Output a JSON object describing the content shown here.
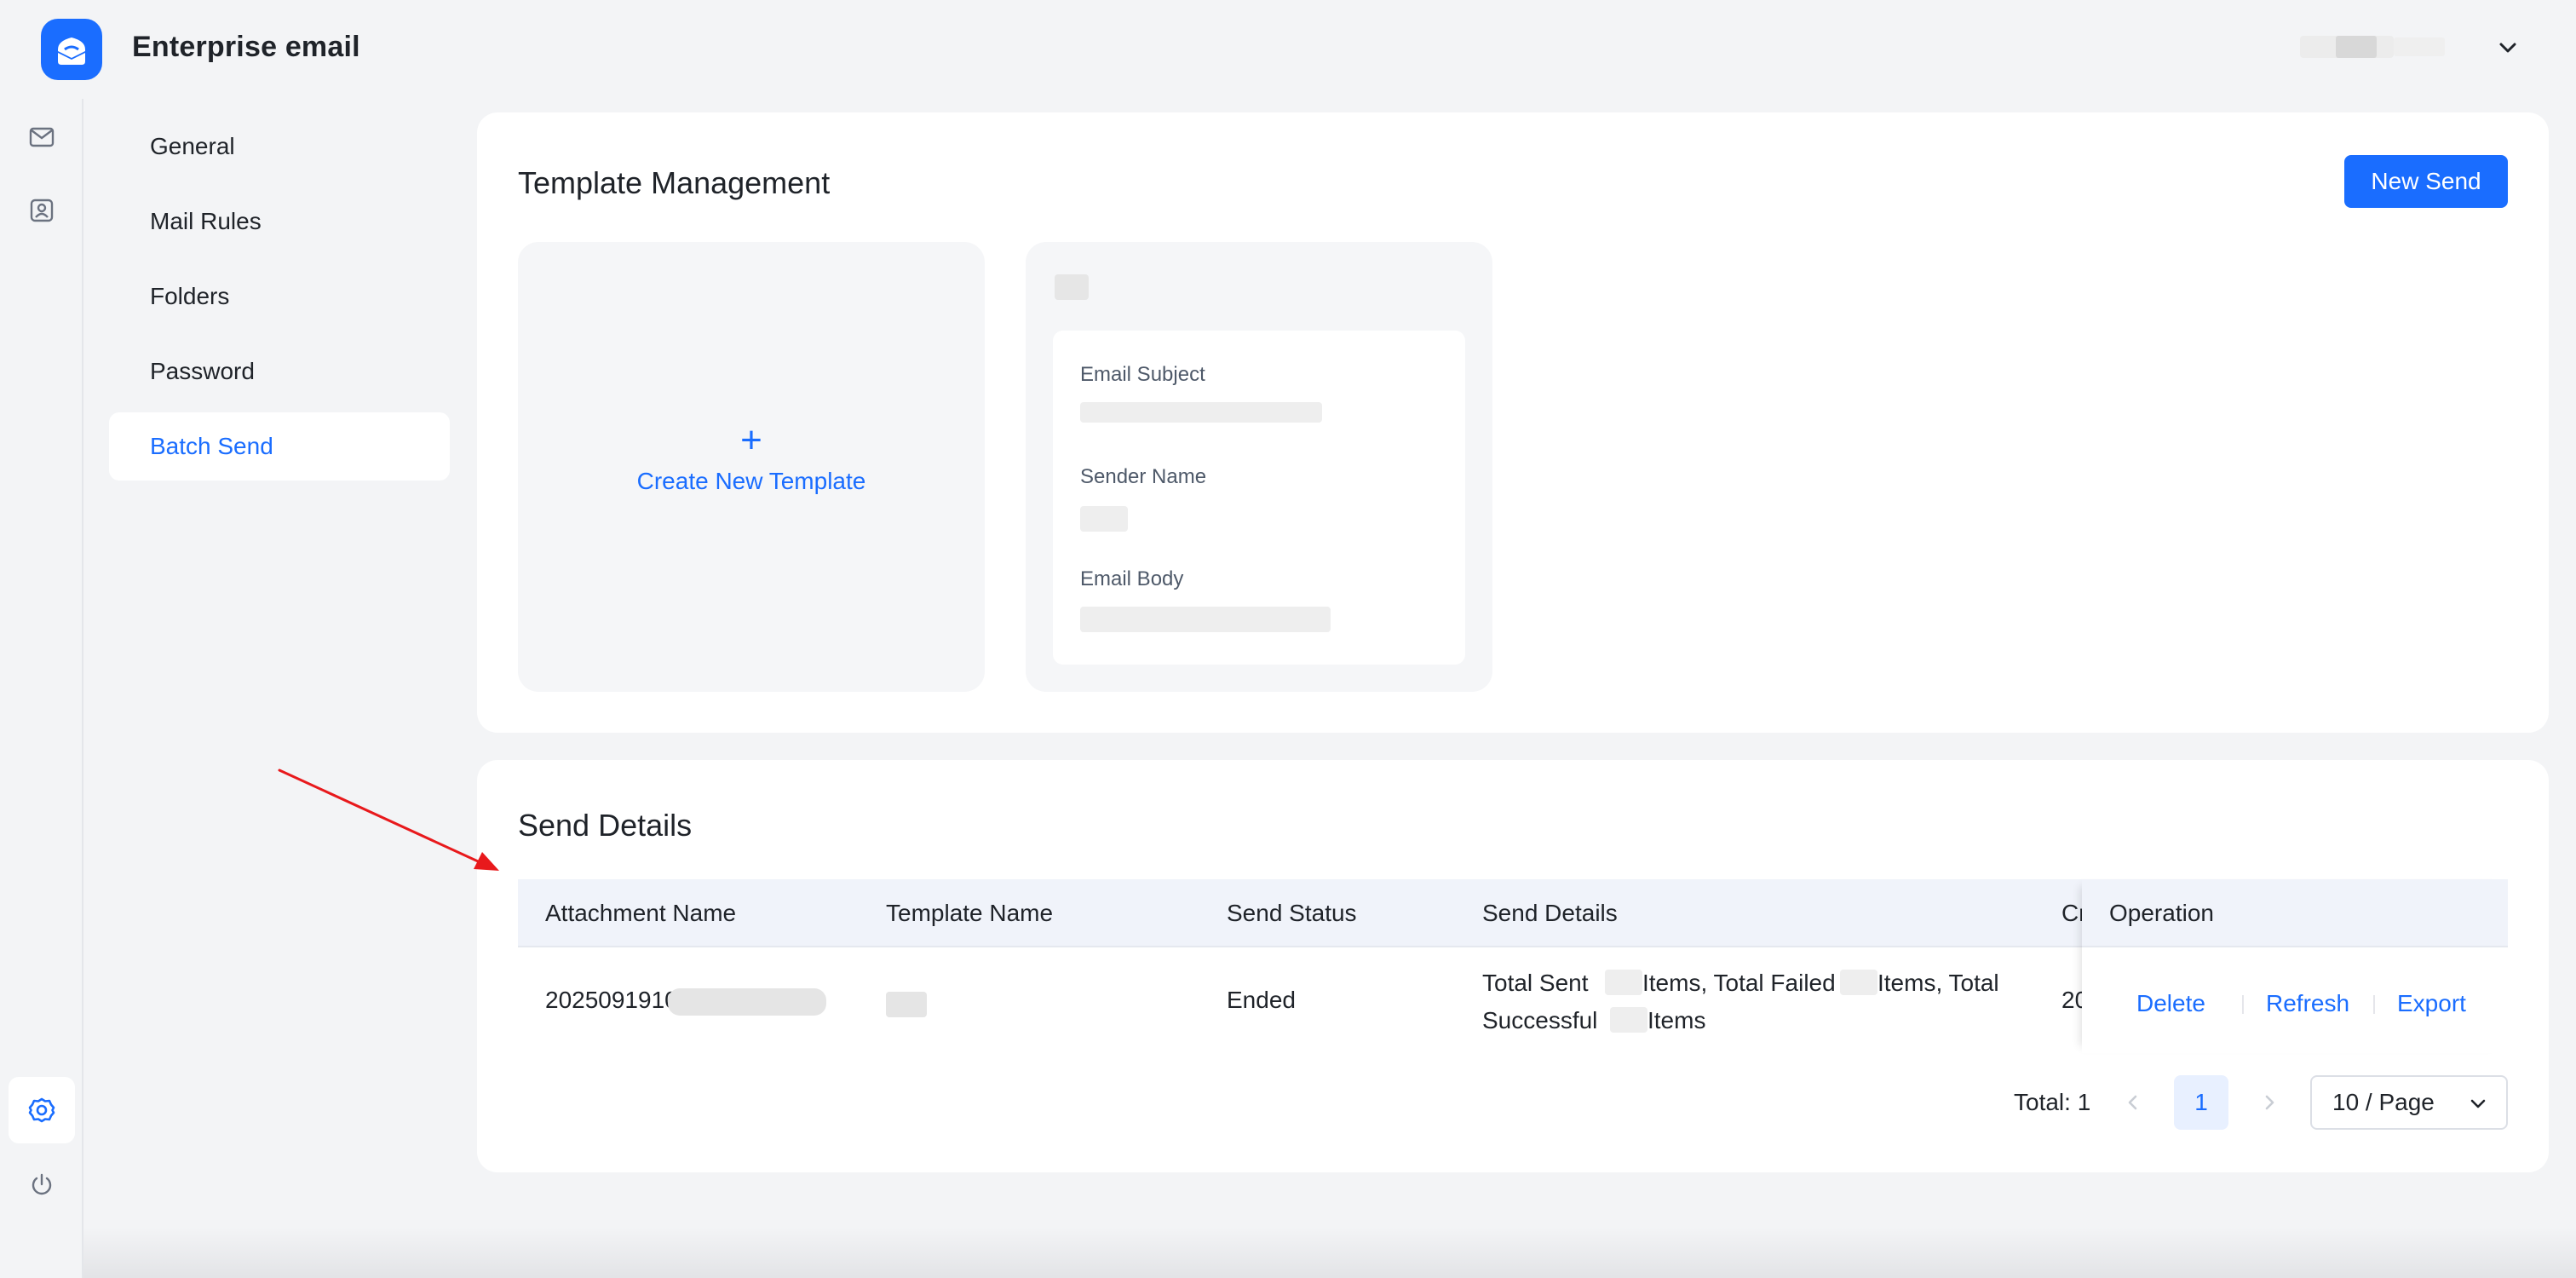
{
  "app": {
    "title": "Enterprise email"
  },
  "settings_menu": {
    "items": [
      {
        "label": "General"
      },
      {
        "label": "Mail Rules"
      },
      {
        "label": "Folders"
      },
      {
        "label": "Password"
      },
      {
        "label": "Batch Send"
      }
    ],
    "active": "Batch Send"
  },
  "template_management": {
    "title": "Template Management",
    "new_send_label": "New Send",
    "create_label": "Create New Template",
    "template_card": {
      "subject_label": "Email Subject",
      "sender_label": "Sender Name",
      "body_label": "Email Body"
    }
  },
  "send_details": {
    "title": "Send Details",
    "columns": [
      "Attachment Name",
      "Template Name",
      "Send Status",
      "Send Details",
      "Cr",
      "Operation"
    ],
    "rows": [
      {
        "attachment_name": "20250919104000",
        "status": "Ended",
        "details_line1": "Total Sent",
        "details_line1b": "Items, Total Failed",
        "details_line1c": "Items, Total",
        "details_line2": "Successful",
        "details_line2b": "Items",
        "created": "20"
      }
    ],
    "operations": [
      "Delete",
      "Refresh",
      "Export"
    ],
    "pagination": {
      "total_label": "Total: 1",
      "current_page": "1",
      "page_size": "10 / Page"
    }
  },
  "colors": {
    "accent": "#1a6dff",
    "annotation": "#e8191c"
  }
}
